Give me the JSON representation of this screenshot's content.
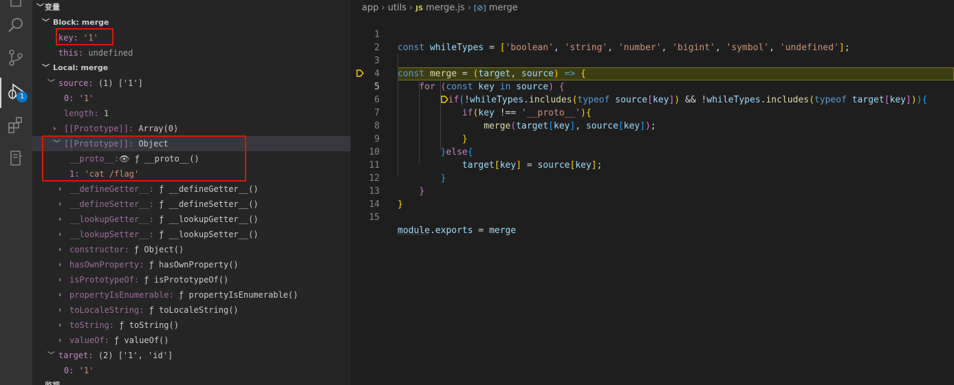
{
  "activity_bar": {
    "items": [
      {
        "name": "explorer-icon"
      },
      {
        "name": "search-icon"
      },
      {
        "name": "source-control-icon"
      },
      {
        "name": "run-debug-icon",
        "badge": "1"
      },
      {
        "name": "extensions-icon"
      },
      {
        "name": "remote-icon"
      }
    ]
  },
  "variables": {
    "title": "变量",
    "block_scope": "Block: merge",
    "key_name": "key:",
    "key_value": "'1'",
    "this_name": "this:",
    "this_value": "undefined",
    "local_scope": "Local: merge",
    "source_name": "source:",
    "source_value": "(1) ['1']",
    "source_0_name": "0:",
    "source_0_value": "'1'",
    "length_name": "length:",
    "length_value": "1",
    "proto_array_name": "[[Prototype]]:",
    "proto_array_value": "Array(0)",
    "proto_obj_name": "[[Prototype]]:",
    "proto_obj_value": "Object",
    "proto_getter_name": "__proto__:",
    "proto_getter_value": "ƒ __proto__()",
    "injected_name": "1:",
    "injected_value": "'cat /flag'",
    "methods": [
      {
        "name": "__defineGetter__:",
        "value": "ƒ __defineGetter__()"
      },
      {
        "name": "__defineSetter__:",
        "value": "ƒ __defineSetter__()"
      },
      {
        "name": "__lookupGetter__:",
        "value": "ƒ __lookupGetter__()"
      },
      {
        "name": "__lookupSetter__:",
        "value": "ƒ __lookupSetter__()"
      },
      {
        "name": "constructor:",
        "value": "ƒ Object()"
      },
      {
        "name": "hasOwnProperty:",
        "value": "ƒ hasOwnProperty()"
      },
      {
        "name": "isPrototypeOf:",
        "value": "ƒ isPrototypeOf()"
      },
      {
        "name": "propertyIsEnumerable:",
        "value": "ƒ propertyIsEnumerable()"
      },
      {
        "name": "toLocaleString:",
        "value": "ƒ toLocaleString()"
      },
      {
        "name": "toString:",
        "value": "ƒ toString()"
      },
      {
        "name": "valueOf:",
        "value": "ƒ valueOf()"
      }
    ],
    "target_name": "target:",
    "target_value": "(2) ['1', 'id']",
    "target_0_name": "0:",
    "target_0_value": "'1'",
    "next_section": "监视"
  },
  "breadcrumbs": {
    "folder1": "app",
    "folder2": "utils",
    "file_badge": "JS",
    "file": "merge.js",
    "symbol": "merge"
  },
  "editor": {
    "line_numbers": [
      "1",
      "2",
      "3",
      "4",
      "5",
      "6",
      "7",
      "8",
      "9",
      "10",
      "11",
      "12",
      "13",
      "14",
      "15"
    ],
    "current_line": "5",
    "tokens": {
      "const": "const",
      "whileTypes": "whileTypes",
      "t_boolean": "'boolean'",
      "t_string": "'string'",
      "t_number": "'number'",
      "t_bigint": "'bigint'",
      "t_symbol": "'symbol'",
      "t_undefined": "'undefined'",
      "merge": "merge",
      "target": "target",
      "source": "source",
      "for": "for",
      "key": "key",
      "in": "in",
      "if": "if",
      "includes": "includes",
      "typeof": "typeof",
      "proto_str": "'__proto__'",
      "else": "else",
      "module": "module",
      "exports": "exports"
    }
  }
}
